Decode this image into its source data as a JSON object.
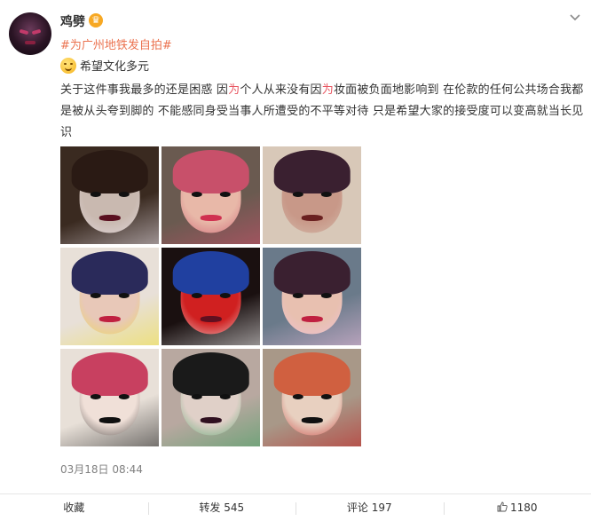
{
  "post": {
    "username": "鸡劈",
    "crown_icon": "crown-icon",
    "hashtag": "#为广州地铁发自拍#",
    "emoji_line": "希望文化多元",
    "text_segments": [
      {
        "t": "关于这件事我最多的还是困惑 因",
        "hl": false
      },
      {
        "t": "为",
        "hl": true
      },
      {
        "t": "个人从来没有因",
        "hl": false
      },
      {
        "t": "为",
        "hl": true
      },
      {
        "t": "妆面被负面地影响到 在伦款的任何公共场合我都是被从头夸到脚的 不能感同身受当事人所遭受的不平等对待 只是希望大家的接受度可以变高就当长见识",
        "hl": false
      }
    ],
    "timestamp": "03月18日 08:44"
  },
  "photos": [
    {
      "bg": "#3a2a20",
      "skin": "#c9b9b0",
      "hair": "#2a1a14",
      "lips": "#5a1020",
      "accent": "#e8e0e8"
    },
    {
      "bg": "#6a5a50",
      "skin": "#e8b8a8",
      "hair": "#c8506a",
      "lips": "#d03050",
      "accent": "#c8506a"
    },
    {
      "bg": "#d8c8b8",
      "skin": "#c89888",
      "hair": "#3a2030",
      "lips": "#6a2020",
      "accent": "#d8c8b8"
    },
    {
      "bg": "#e8e0d8",
      "skin": "#e8c8b8",
      "hair": "#2a2a5a",
      "lips": "#c02040",
      "accent": "#f0e040"
    },
    {
      "bg": "#1a1010",
      "skin": "#d02020",
      "hair": "#2040a0",
      "lips": "#601020",
      "accent": "#f0f0f0"
    },
    {
      "bg": "#6a7a8a",
      "skin": "#e8c0b0",
      "hair": "#3a2030",
      "lips": "#c02040",
      "accent": "#f0c0e0"
    },
    {
      "bg": "#e8e0d8",
      "skin": "#f0e0d8",
      "hair": "#c84060",
      "lips": "#101010",
      "accent": "#202020"
    },
    {
      "bg": "#b8a8a0",
      "skin": "#e0d0c8",
      "hair": "#1a1a1a",
      "lips": "#301020",
      "accent": "#40a060"
    },
    {
      "bg": "#a89888",
      "skin": "#e8d0c0",
      "hair": "#d06040",
      "lips": "#101010",
      "accent": "#c02020"
    }
  ],
  "actions": {
    "favorite": "收藏",
    "repost": "转发 545",
    "comment": "评论 197",
    "like": "1180"
  },
  "colors": {
    "hashtag": "#eb7350",
    "highlight": "#e8545f",
    "crown": "#f7a823"
  }
}
